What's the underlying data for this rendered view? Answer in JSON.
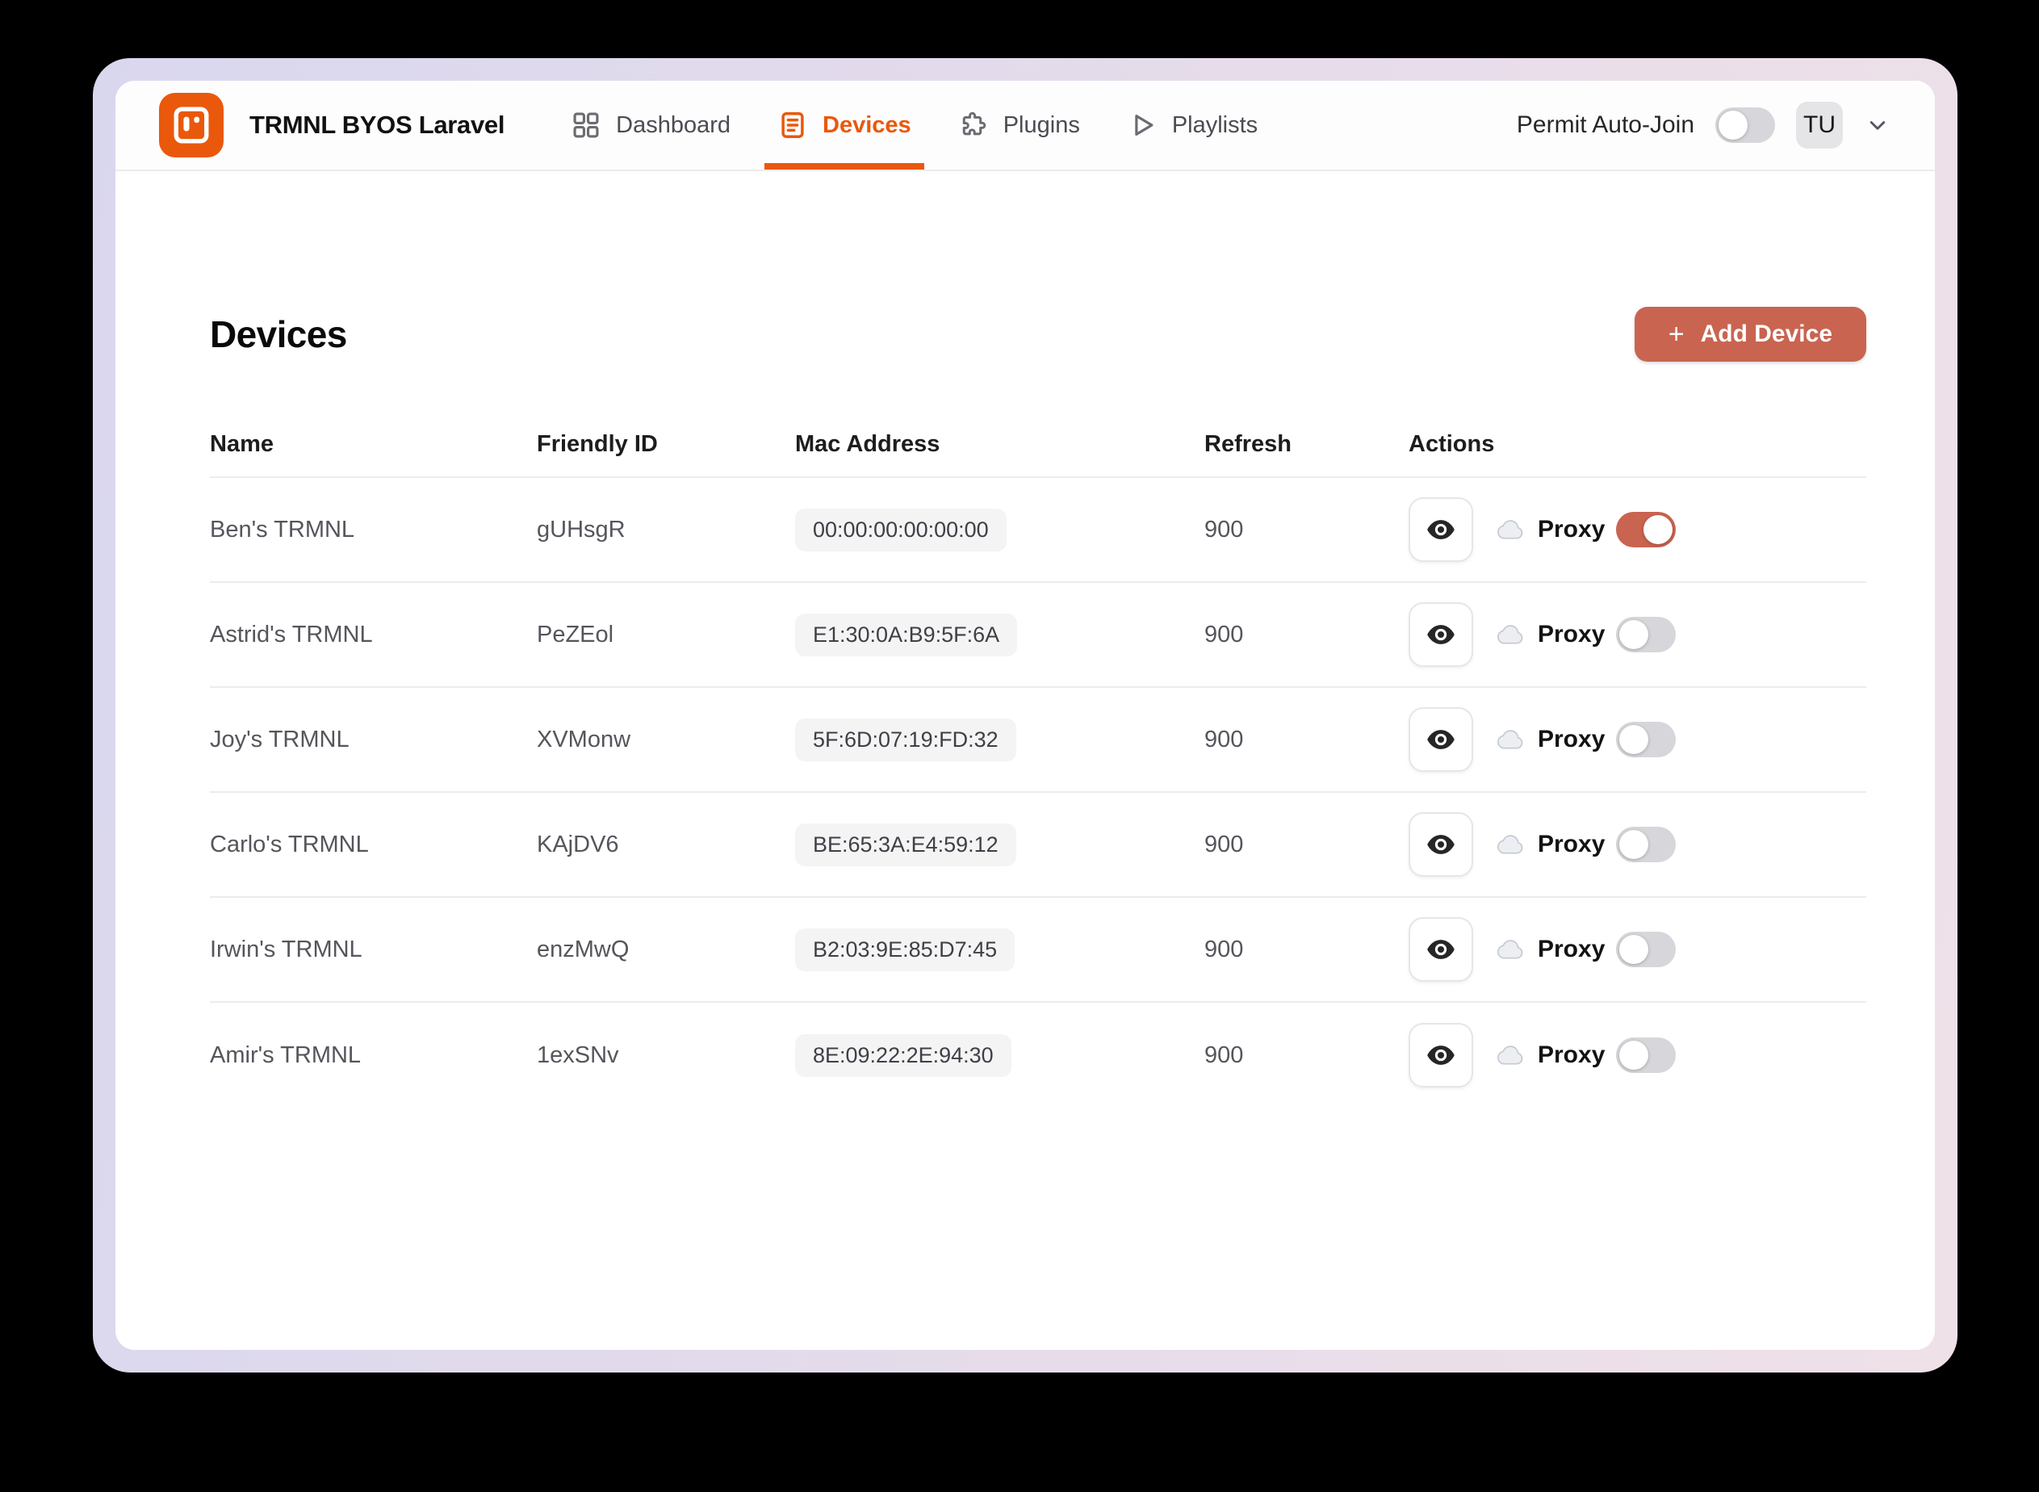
{
  "header": {
    "app_title": "TRMNL BYOS Laravel",
    "nav": [
      {
        "label": "Dashboard",
        "icon": "dashboard-grid-icon",
        "active": false
      },
      {
        "label": "Devices",
        "icon": "devices-list-icon",
        "active": true
      },
      {
        "label": "Plugins",
        "icon": "puzzle-icon",
        "active": false
      },
      {
        "label": "Playlists",
        "icon": "play-icon",
        "active": false
      }
    ],
    "permit_auto_join": {
      "label": "Permit Auto-Join",
      "enabled": false
    },
    "avatar_initials": "TU",
    "chevron_icon": "chevron-down-icon"
  },
  "page": {
    "title": "Devices",
    "add_device": {
      "label": "Add Device",
      "plus": "+"
    }
  },
  "table": {
    "columns": [
      "Name",
      "Friendly ID",
      "Mac Address",
      "Refresh",
      "Actions"
    ],
    "proxy_label": "Proxy",
    "icons": {
      "view": "eye-icon",
      "proxy": "cloud-icon"
    },
    "rows": [
      {
        "name": "Ben's TRMNL",
        "friendly_id": "gUHsgR",
        "mac": "00:00:00:00:00:00",
        "refresh": "900",
        "proxy_on": true
      },
      {
        "name": "Astrid's TRMNL",
        "friendly_id": "PeZEol",
        "mac": "E1:30:0A:B9:5F:6A",
        "refresh": "900",
        "proxy_on": false
      },
      {
        "name": "Joy's TRMNL",
        "friendly_id": "XVMonw",
        "mac": "5F:6D:07:19:FD:32",
        "refresh": "900",
        "proxy_on": false
      },
      {
        "name": "Carlo's TRMNL",
        "friendly_id": "KAjDV6",
        "mac": "BE:65:3A:E4:59:12",
        "refresh": "900",
        "proxy_on": false
      },
      {
        "name": "Irwin's TRMNL",
        "friendly_id": "enzMwQ",
        "mac": "B2:03:9E:85:D7:45",
        "refresh": "900",
        "proxy_on": false
      },
      {
        "name": "Amir's TRMNL",
        "friendly_id": "1exSNv",
        "mac": "8E:09:22:2E:94:30",
        "refresh": "900",
        "proxy_on": false
      }
    ]
  },
  "colors": {
    "brand_orange": "#ea580c",
    "accent_terracotta": "#c96450",
    "toggle_off": "#d7d7db",
    "badge_bg": "#f4f4f5",
    "frame_gradient_left": "#d9d7ee",
    "frame_gradient_right": "#efe1e8"
  }
}
